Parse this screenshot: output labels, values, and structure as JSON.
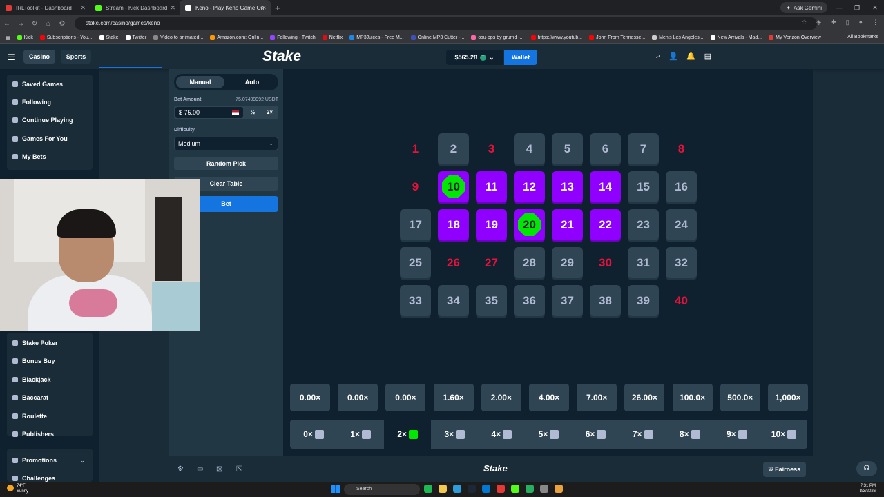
{
  "browser": {
    "tabs": [
      {
        "title": "IRLToolkit - Dashboard",
        "color": "#e53935",
        "active": false
      },
      {
        "title": "Stream - Kick Dashboard",
        "color": "#53fc18",
        "active": false
      },
      {
        "title": "Keno - Play Keno Game On",
        "color": "#ffffff",
        "active": true
      }
    ],
    "ask_gemini": "Ask Gemini",
    "url": "stake.com/casino/games/keno",
    "bookmarks": [
      {
        "label": "Kick",
        "color": "#53fc18"
      },
      {
        "label": "Subscriptions - You...",
        "color": "#ff0000"
      },
      {
        "label": "Stake",
        "color": "#ffffff"
      },
      {
        "label": "Twitter",
        "color": "#ffffff"
      },
      {
        "label": "Video to animated...",
        "color": "#888888"
      },
      {
        "label": "Amazon.com: Onlin...",
        "color": "#ff9900"
      },
      {
        "label": "Following - Twitch",
        "color": "#9146ff"
      },
      {
        "label": "Netflix",
        "color": "#e50914"
      },
      {
        "label": "MP3Juices - Free M...",
        "color": "#1e88e5"
      },
      {
        "label": "Online MP3 Cutter -...",
        "color": "#3f51b5"
      },
      {
        "label": "osu-pps by grumd -...",
        "color": "#ff66aa"
      },
      {
        "label": "https://www.youtub...",
        "color": "#ff0000"
      },
      {
        "label": "John From Tennesse...",
        "color": "#ff0000"
      },
      {
        "label": "Men's Los Angeles...",
        "color": "#cccccc"
      },
      {
        "label": "New Arrivals - Mad...",
        "color": "#ffffff"
      },
      {
        "label": "My Verizon Overview",
        "color": "#e53935"
      }
    ],
    "all_bookmarks": "All Bookmarks"
  },
  "header": {
    "casino": "Casino",
    "sports": "Sports",
    "logo": "Stake",
    "balance": "$565.28",
    "coin": "T",
    "wallet": "Wallet"
  },
  "sidebar": {
    "top_items": [
      "Saved Games",
      "Following",
      "Continue Playing",
      "Games For You",
      "My Bets"
    ],
    "bottom_items": [
      "Stake Poker",
      "Bonus Buy",
      "Blackjack",
      "Baccarat",
      "Roulette",
      "Publishers"
    ],
    "promotions": "Promotions",
    "challenges": "Challenges"
  },
  "controls": {
    "manual": "Manual",
    "auto": "Auto",
    "bet_amount_label": "Bet Amount",
    "bet_amount_crypto": "75.07499992 USDT",
    "bet_currency_symbol": "$",
    "bet_amount_value": "75.00",
    "half": "½",
    "double": "2×",
    "difficulty_label": "Difficulty",
    "difficulty_value": "Medium",
    "random_pick": "Random Pick",
    "clear_table": "Clear Table",
    "bet": "Bet"
  },
  "board": {
    "tiles": [
      {
        "n": "1",
        "state": "miss"
      },
      {
        "n": "2",
        "state": "idle"
      },
      {
        "n": "3",
        "state": "miss"
      },
      {
        "n": "4",
        "state": "idle"
      },
      {
        "n": "5",
        "state": "idle"
      },
      {
        "n": "6",
        "state": "idle"
      },
      {
        "n": "7",
        "state": "idle"
      },
      {
        "n": "8",
        "state": "miss"
      },
      {
        "n": "9",
        "state": "miss"
      },
      {
        "n": "10",
        "state": "hit"
      },
      {
        "n": "11",
        "state": "sel"
      },
      {
        "n": "12",
        "state": "sel"
      },
      {
        "n": "13",
        "state": "sel"
      },
      {
        "n": "14",
        "state": "sel"
      },
      {
        "n": "15",
        "state": "idle"
      },
      {
        "n": "16",
        "state": "idle"
      },
      {
        "n": "17",
        "state": "idle"
      },
      {
        "n": "18",
        "state": "sel"
      },
      {
        "n": "19",
        "state": "sel"
      },
      {
        "n": "20",
        "state": "hit"
      },
      {
        "n": "21",
        "state": "sel"
      },
      {
        "n": "22",
        "state": "sel"
      },
      {
        "n": "23",
        "state": "idle"
      },
      {
        "n": "24",
        "state": "idle"
      },
      {
        "n": "25",
        "state": "idle"
      },
      {
        "n": "26",
        "state": "miss"
      },
      {
        "n": "27",
        "state": "miss"
      },
      {
        "n": "28",
        "state": "idle"
      },
      {
        "n": "29",
        "state": "idle"
      },
      {
        "n": "30",
        "state": "miss"
      },
      {
        "n": "31",
        "state": "idle"
      },
      {
        "n": "32",
        "state": "idle"
      },
      {
        "n": "33",
        "state": "idle"
      },
      {
        "n": "34",
        "state": "idle"
      },
      {
        "n": "35",
        "state": "idle"
      },
      {
        "n": "36",
        "state": "idle"
      },
      {
        "n": "37",
        "state": "idle"
      },
      {
        "n": "38",
        "state": "idle"
      },
      {
        "n": "39",
        "state": "idle"
      },
      {
        "n": "40",
        "state": "miss"
      }
    ]
  },
  "payouts": [
    "0.00×",
    "0.00×",
    "0.00×",
    "1.60×",
    "2.00×",
    "4.00×",
    "7.00×",
    "26.00×",
    "100.0×",
    "500.0×",
    "1,000×"
  ],
  "hits": [
    {
      "label": "0×",
      "active": false
    },
    {
      "label": "1×",
      "active": false
    },
    {
      "label": "2×",
      "active": true
    },
    {
      "label": "3×",
      "active": false
    },
    {
      "label": "4×",
      "active": false
    },
    {
      "label": "5×",
      "active": false
    },
    {
      "label": "6×",
      "active": false
    },
    {
      "label": "7×",
      "active": false
    },
    {
      "label": "8×",
      "active": false
    },
    {
      "label": "9×",
      "active": false
    },
    {
      "label": "10×",
      "active": false
    }
  ],
  "footer": {
    "logo": "Stake",
    "fairness": "Fairness"
  },
  "taskbar": {
    "temperature": "74°F",
    "weather": "Sunny",
    "search": "Search",
    "time": "7:31 PM",
    "date": "8/3/2026"
  }
}
